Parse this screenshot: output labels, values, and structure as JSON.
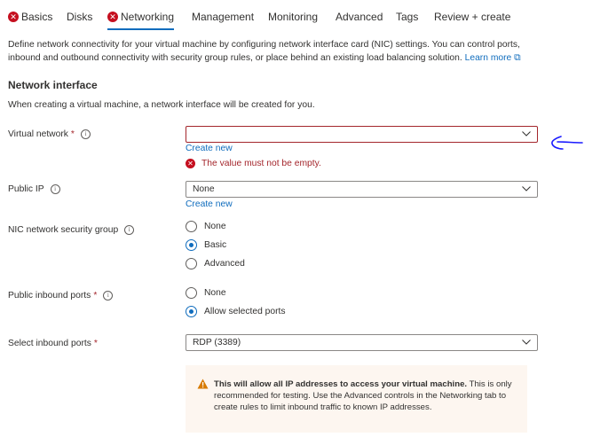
{
  "tabs": [
    {
      "label": "Basics",
      "error": true
    },
    {
      "label": "Disks",
      "error": false
    },
    {
      "label": "Networking",
      "error": true,
      "active": true
    },
    {
      "label": "Management",
      "error": false
    },
    {
      "label": "Monitoring",
      "error": false
    },
    {
      "label": "Advanced",
      "error": false
    },
    {
      "label": "Tags",
      "error": false
    },
    {
      "label": "Review + create",
      "error": false
    }
  ],
  "intro": {
    "text": "Define network connectivity for your virtual machine by configuring network interface card (NIC) settings. You can control ports, inbound and outbound connectivity with security group rules, or place behind an existing load balancing solution.",
    "learn_more": "Learn more"
  },
  "network_interface": {
    "title": "Network interface",
    "description": "When creating a virtual machine, a network interface will be created for you."
  },
  "fields": {
    "virtual_network": {
      "label": "Virtual network",
      "required": "*",
      "value": "",
      "create_new": "Create new",
      "error": "The value must not be empty."
    },
    "public_ip": {
      "label": "Public IP",
      "value": "None",
      "create_new": "Create new"
    },
    "nic_nsg": {
      "label": "NIC network security group",
      "options": [
        "None",
        "Basic",
        "Advanced"
      ],
      "selected": "Basic"
    },
    "public_inbound_ports": {
      "label": "Public inbound ports",
      "required": "*",
      "options": [
        "None",
        "Allow selected ports"
      ],
      "selected": "Allow selected ports"
    },
    "select_inbound_ports": {
      "label": "Select inbound ports",
      "required": "*",
      "value": "RDP (3389)"
    }
  },
  "warning": {
    "bold": "This will allow all IP addresses to access your virtual machine.",
    "text": "This is only recommended for testing.  Use the Advanced controls in the Networking tab to create rules to limit inbound traffic to known IP addresses."
  },
  "colors": {
    "accent": "#0f6cbd",
    "error": "#a4262c",
    "warning_bg": "#fdf6f0",
    "annotation_arrow": "#1a1aff"
  }
}
